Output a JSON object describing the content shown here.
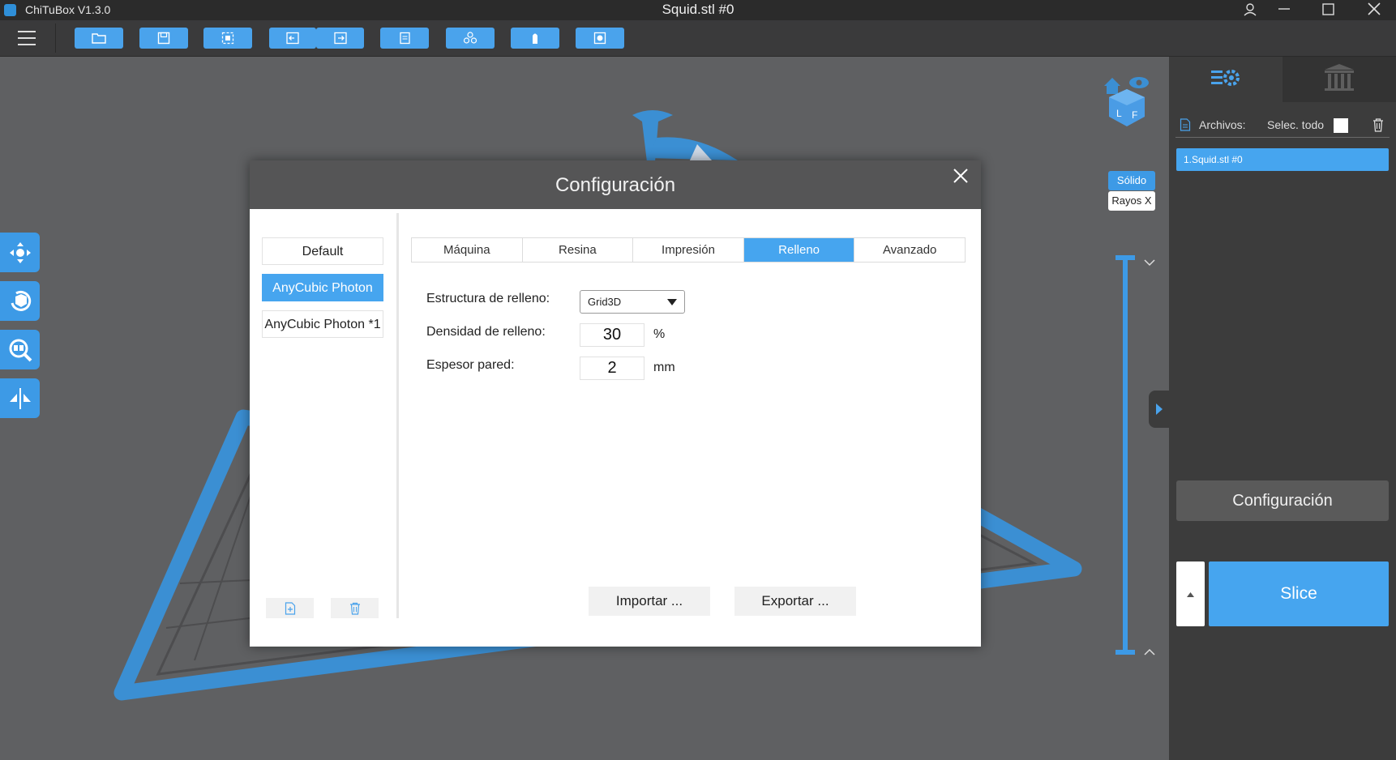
{
  "app": {
    "title": "ChiTuBox V1.3.0",
    "document": "Squid.stl #0"
  },
  "toolbar": {
    "buttons": [
      "open-folder-icon",
      "save-icon",
      "select-icon",
      "import-icon",
      "export-icon",
      "copy-icon",
      "arrange-icon",
      "supports-icon",
      "hollow-icon"
    ]
  },
  "viewport": {
    "view_modes": {
      "solid": "Sólido",
      "xray": "Rayos X"
    }
  },
  "right_panel": {
    "files_label": "Archivos:",
    "select_all_label": "Selec. todo",
    "select_all_checked": false,
    "files": [
      "1.Squid.stl #0"
    ],
    "config_button": "Configuración",
    "slice_button": "Slice"
  },
  "dialog": {
    "title": "Configuración",
    "profiles": [
      "Default",
      "AnyCubic Photon",
      "AnyCubic Photon *1"
    ],
    "active_profile": "AnyCubic Photon",
    "tabs": [
      "Máquina",
      "Resina",
      "Impresión",
      "Relleno",
      "Avanzado"
    ],
    "active_tab": "Relleno",
    "fields": {
      "structure": {
        "label": "Estructura de relleno:",
        "value": "Grid3D"
      },
      "density": {
        "label": "Densidad de relleno:",
        "value": "30",
        "unit": "%"
      },
      "wall": {
        "label": "Espesor pared:",
        "value": "2",
        "unit": "mm"
      }
    },
    "import_button": "Importar ...",
    "export_button": "Exportar ..."
  },
  "colors": {
    "accent": "#46a5ef",
    "titlebar": "#2b2b2b",
    "toolbar": "#3a3a3b",
    "viewport": "#5f6062",
    "panel": "#3c3c3c",
    "model": "#3b8fd3"
  }
}
